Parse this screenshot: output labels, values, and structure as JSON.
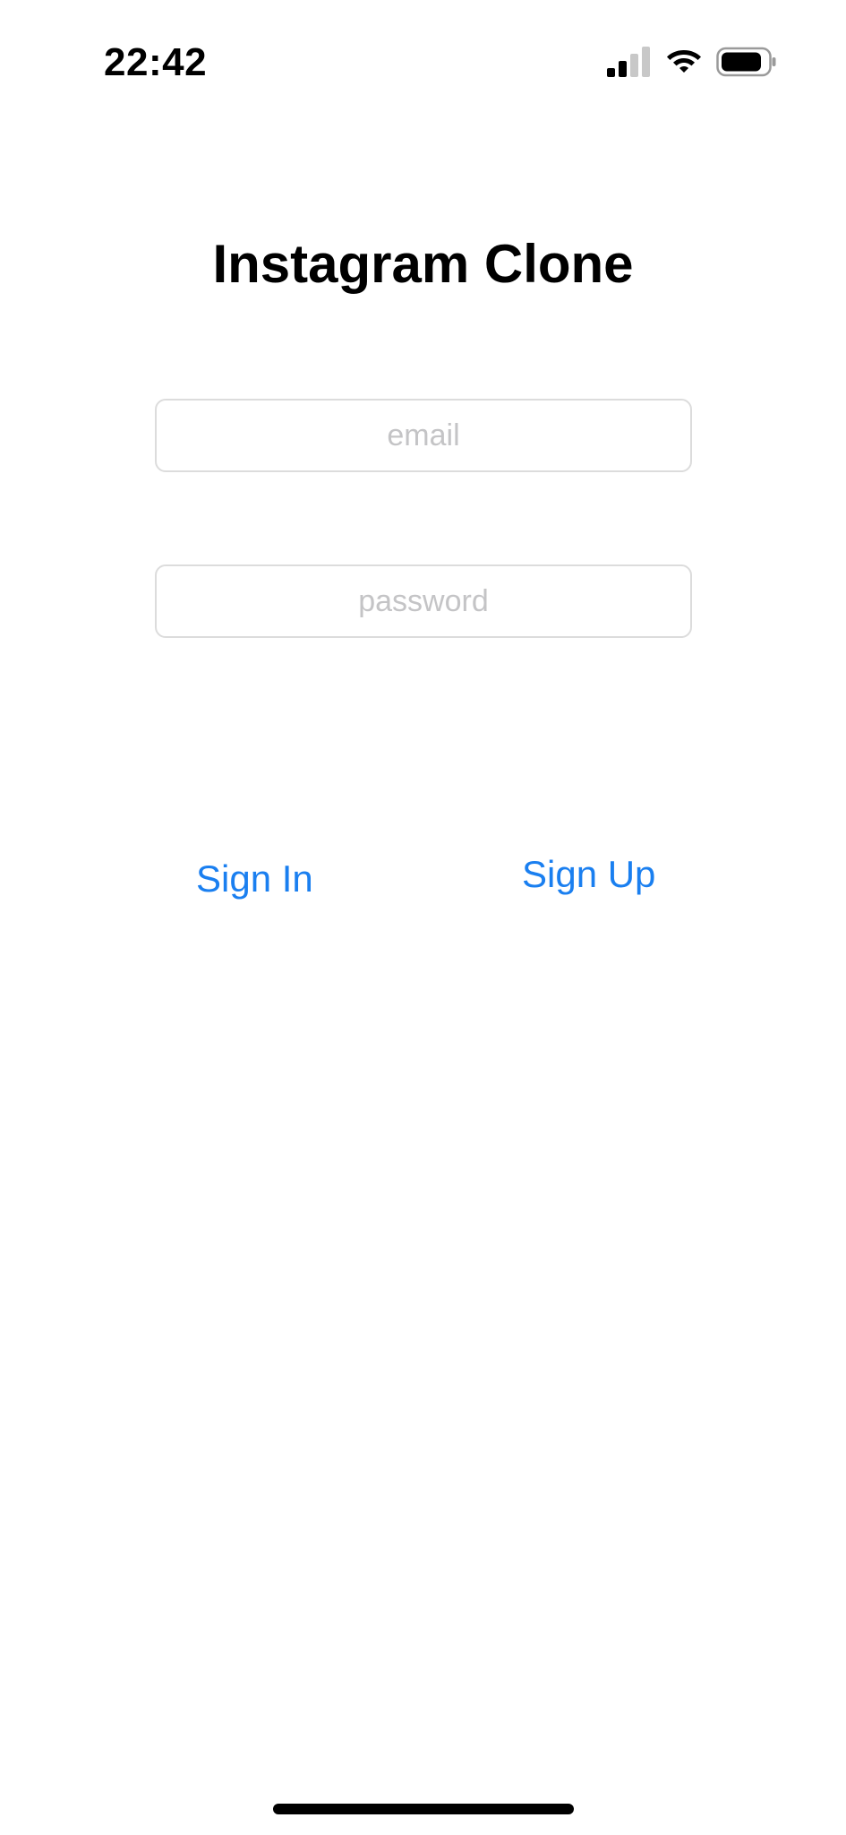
{
  "status_bar": {
    "time": "22:42",
    "signal_icon": "cellular-signal-icon",
    "wifi_icon": "wifi-icon",
    "battery_icon": "battery-icon"
  },
  "title": "Instagram Clone",
  "form": {
    "email": {
      "value": "",
      "placeholder": "email"
    },
    "password": {
      "value": "",
      "placeholder": "password"
    }
  },
  "actions": {
    "sign_in_label": "Sign In",
    "sign_up_label": "Sign Up"
  },
  "colors": {
    "accent": "#1a7ff0",
    "placeholder": "#c4c4c6",
    "field_border": "#dcdcdc",
    "background": "#ffffff"
  }
}
